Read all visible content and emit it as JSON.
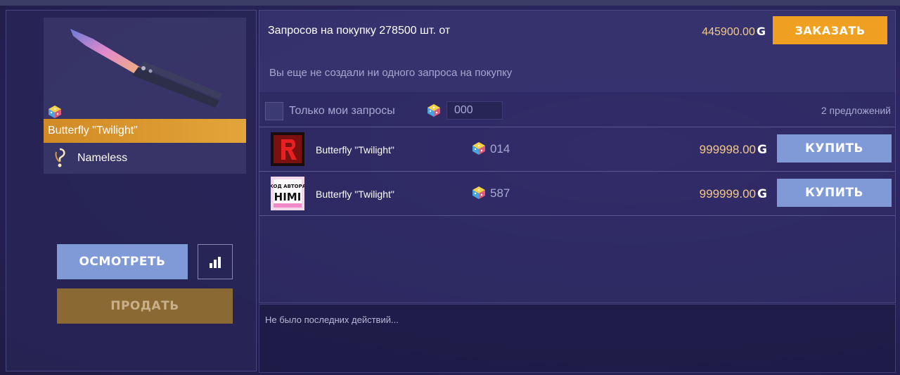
{
  "item": {
    "name": "Butterfly \"Twilight\"",
    "owner": "Nameless"
  },
  "actions": {
    "inspect_label": "ОСМОТРЕТЬ",
    "sell_label": "ПРОДАТЬ",
    "chart_icon": "bar-chart-icon"
  },
  "requests": {
    "title": "Запросов на покупку 278500 шт. от",
    "price": "445900.00",
    "currency_symbol": "G",
    "order_label": "ЗАКАЗАТЬ",
    "empty_text": "Вы еще не создали ни одного запроса на покупку"
  },
  "filter": {
    "only_mine_label": "Только мои запросы",
    "code_value": "000",
    "offers_count": "2 предложений"
  },
  "offers": [
    {
      "name": "Butterfly \"Twilight\"",
      "id": "014",
      "price": "999998.00",
      "buy_label": "КУПИТЬ",
      "avatar": "red-r-logo"
    },
    {
      "name": "Butterfly \"Twilight\"",
      "id": "587",
      "price": "999999.00",
      "buy_label": "КУПИТЬ",
      "avatar_text_top": "КОД АВТОРА",
      "avatar_text_bottom": "HIMI"
    }
  ],
  "activity": {
    "empty_text": "Не было последних действий..."
  },
  "colors": {
    "accent_orange": "#f0a020",
    "button_blue": "#7f9ad6",
    "price_gold": "#f3c98a",
    "name_bar_gold": "#e3a53a"
  }
}
